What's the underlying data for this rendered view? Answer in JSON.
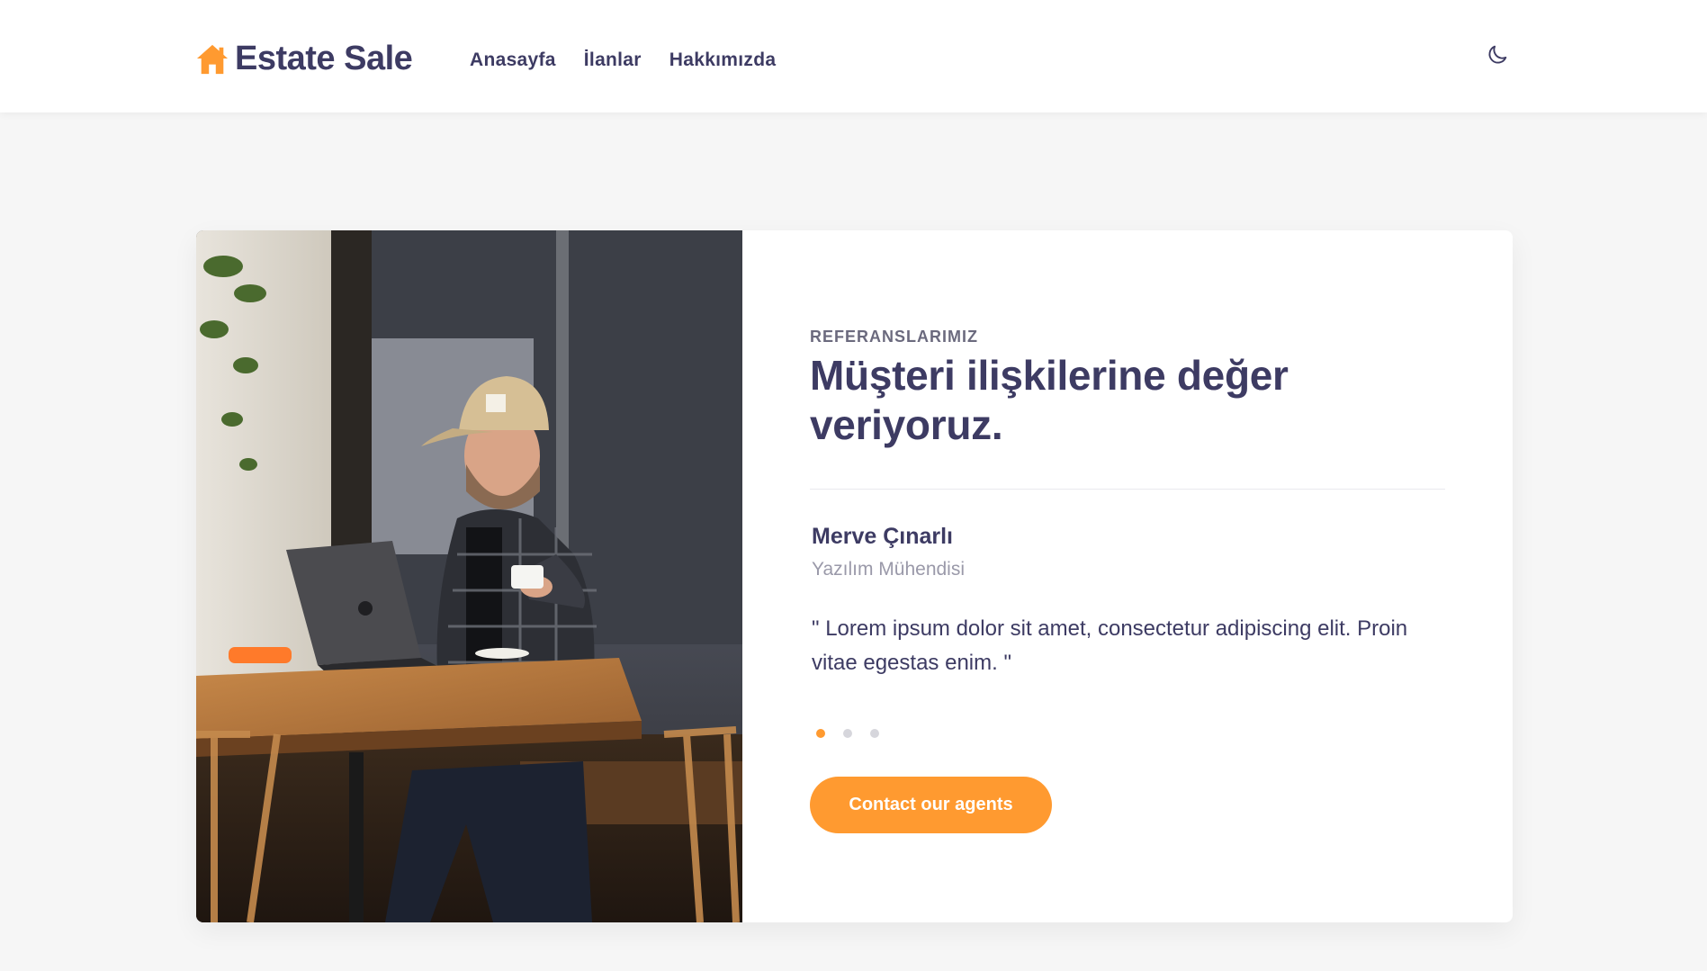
{
  "header": {
    "logo_text": "Estate Sale",
    "nav": [
      {
        "label": "Anasayfa"
      },
      {
        "label": "İlanlar"
      },
      {
        "label": "Hakkımızda"
      }
    ]
  },
  "testimonial": {
    "eyebrow": "REFERANSLARIMIZ",
    "headline": "Müşteri ilişkilerine değer veriyoruz.",
    "person_name": "Merve Çınarlı",
    "person_role": "Yazılım Mühendisi",
    "quote": "\" Lorem ipsum dolor sit amet, consectetur adipiscing elit. Proin vitae egestas enim. \"",
    "slides_total": 3,
    "active_slide": 1,
    "cta_label": "Contact our agents"
  },
  "colors": {
    "accent": "#ff9a30",
    "text_primary": "#3d3b63",
    "text_muted": "#9a99a9",
    "background": "#f6f6f6"
  },
  "icons": {
    "logo": "home-icon",
    "theme_toggle": "moon-icon"
  }
}
